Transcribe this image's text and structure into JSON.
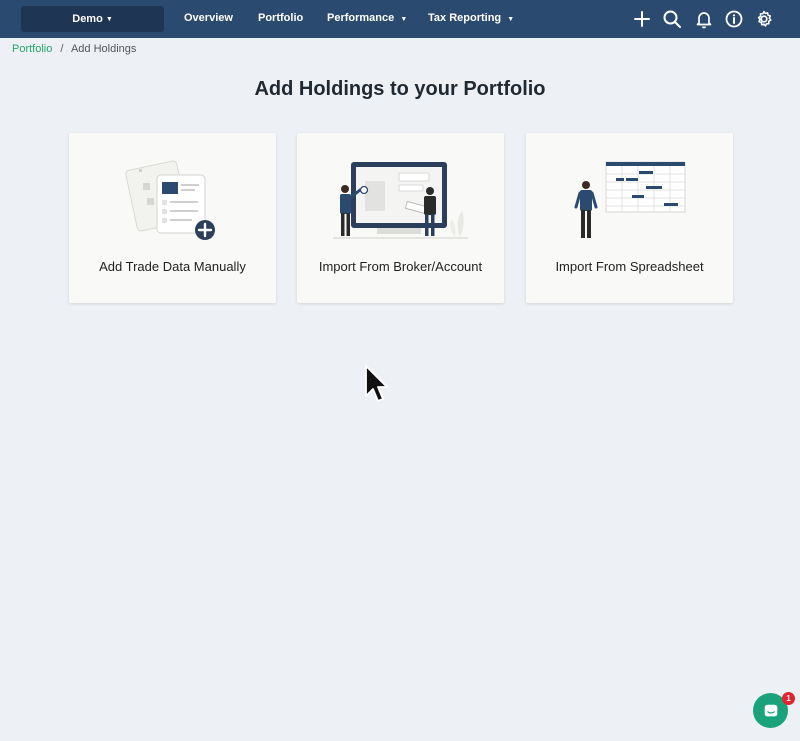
{
  "nav": {
    "portfolio_select": "Demo",
    "links": [
      {
        "label": "Overview"
      },
      {
        "label": "Portfolio"
      },
      {
        "label": "Performance"
      },
      {
        "label": "Tax Reporting"
      }
    ],
    "icons": [
      "plus-icon",
      "search-icon",
      "bell-icon",
      "info-icon",
      "gear-icon"
    ]
  },
  "breadcrumb": {
    "root": "Portfolio",
    "current": "Add Holdings"
  },
  "main": {
    "title": "Add Holdings to your Portfolio",
    "cards": [
      {
        "label": "Add Trade Data Manually",
        "icon": "manual-entry-illustration"
      },
      {
        "label": "Import From Broker/Account",
        "icon": "broker-import-illustration"
      },
      {
        "label": "Import From Spreadsheet",
        "icon": "spreadsheet-import-illustration"
      }
    ]
  },
  "chat": {
    "badge_count": "1"
  },
  "colors": {
    "nav_bg": "#2b4a6f",
    "accent_green": "#27a36a",
    "chat_green": "#1aa37a",
    "badge_red": "#e0252f"
  }
}
